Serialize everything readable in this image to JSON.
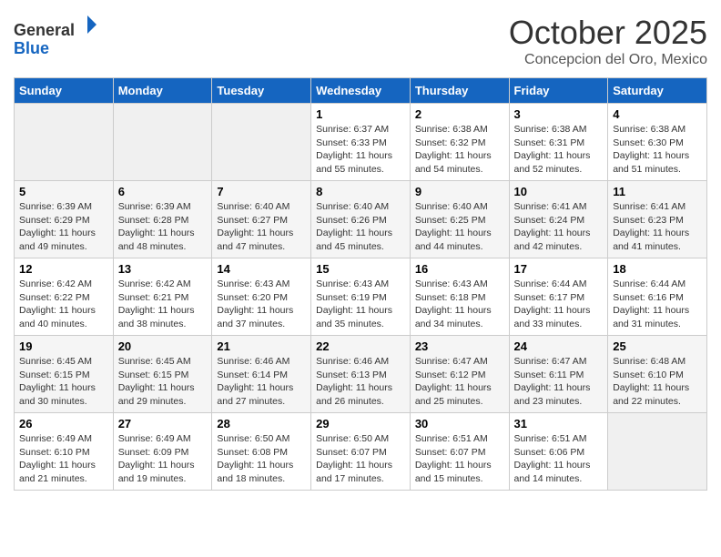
{
  "header": {
    "logo_general": "General",
    "logo_blue": "Blue",
    "month": "October 2025",
    "location": "Concepcion del Oro, Mexico"
  },
  "days_of_week": [
    "Sunday",
    "Monday",
    "Tuesday",
    "Wednesday",
    "Thursday",
    "Friday",
    "Saturday"
  ],
  "weeks": [
    [
      {
        "day": "",
        "empty": true
      },
      {
        "day": "",
        "empty": true
      },
      {
        "day": "",
        "empty": true
      },
      {
        "day": "1",
        "sunrise": "6:37 AM",
        "sunset": "6:33 PM",
        "daylight": "11 hours and 55 minutes."
      },
      {
        "day": "2",
        "sunrise": "6:38 AM",
        "sunset": "6:32 PM",
        "daylight": "11 hours and 54 minutes."
      },
      {
        "day": "3",
        "sunrise": "6:38 AM",
        "sunset": "6:31 PM",
        "daylight": "11 hours and 52 minutes."
      },
      {
        "day": "4",
        "sunrise": "6:38 AM",
        "sunset": "6:30 PM",
        "daylight": "11 hours and 51 minutes."
      }
    ],
    [
      {
        "day": "5",
        "sunrise": "6:39 AM",
        "sunset": "6:29 PM",
        "daylight": "11 hours and 49 minutes."
      },
      {
        "day": "6",
        "sunrise": "6:39 AM",
        "sunset": "6:28 PM",
        "daylight": "11 hours and 48 minutes."
      },
      {
        "day": "7",
        "sunrise": "6:40 AM",
        "sunset": "6:27 PM",
        "daylight": "11 hours and 47 minutes."
      },
      {
        "day": "8",
        "sunrise": "6:40 AM",
        "sunset": "6:26 PM",
        "daylight": "11 hours and 45 minutes."
      },
      {
        "day": "9",
        "sunrise": "6:40 AM",
        "sunset": "6:25 PM",
        "daylight": "11 hours and 44 minutes."
      },
      {
        "day": "10",
        "sunrise": "6:41 AM",
        "sunset": "6:24 PM",
        "daylight": "11 hours and 42 minutes."
      },
      {
        "day": "11",
        "sunrise": "6:41 AM",
        "sunset": "6:23 PM",
        "daylight": "11 hours and 41 minutes."
      }
    ],
    [
      {
        "day": "12",
        "sunrise": "6:42 AM",
        "sunset": "6:22 PM",
        "daylight": "11 hours and 40 minutes."
      },
      {
        "day": "13",
        "sunrise": "6:42 AM",
        "sunset": "6:21 PM",
        "daylight": "11 hours and 38 minutes."
      },
      {
        "day": "14",
        "sunrise": "6:43 AM",
        "sunset": "6:20 PM",
        "daylight": "11 hours and 37 minutes."
      },
      {
        "day": "15",
        "sunrise": "6:43 AM",
        "sunset": "6:19 PM",
        "daylight": "11 hours and 35 minutes."
      },
      {
        "day": "16",
        "sunrise": "6:43 AM",
        "sunset": "6:18 PM",
        "daylight": "11 hours and 34 minutes."
      },
      {
        "day": "17",
        "sunrise": "6:44 AM",
        "sunset": "6:17 PM",
        "daylight": "11 hours and 33 minutes."
      },
      {
        "day": "18",
        "sunrise": "6:44 AM",
        "sunset": "6:16 PM",
        "daylight": "11 hours and 31 minutes."
      }
    ],
    [
      {
        "day": "19",
        "sunrise": "6:45 AM",
        "sunset": "6:15 PM",
        "daylight": "11 hours and 30 minutes."
      },
      {
        "day": "20",
        "sunrise": "6:45 AM",
        "sunset": "6:15 PM",
        "daylight": "11 hours and 29 minutes."
      },
      {
        "day": "21",
        "sunrise": "6:46 AM",
        "sunset": "6:14 PM",
        "daylight": "11 hours and 27 minutes."
      },
      {
        "day": "22",
        "sunrise": "6:46 AM",
        "sunset": "6:13 PM",
        "daylight": "11 hours and 26 minutes."
      },
      {
        "day": "23",
        "sunrise": "6:47 AM",
        "sunset": "6:12 PM",
        "daylight": "11 hours and 25 minutes."
      },
      {
        "day": "24",
        "sunrise": "6:47 AM",
        "sunset": "6:11 PM",
        "daylight": "11 hours and 23 minutes."
      },
      {
        "day": "25",
        "sunrise": "6:48 AM",
        "sunset": "6:10 PM",
        "daylight": "11 hours and 22 minutes."
      }
    ],
    [
      {
        "day": "26",
        "sunrise": "6:49 AM",
        "sunset": "6:10 PM",
        "daylight": "11 hours and 21 minutes."
      },
      {
        "day": "27",
        "sunrise": "6:49 AM",
        "sunset": "6:09 PM",
        "daylight": "11 hours and 19 minutes."
      },
      {
        "day": "28",
        "sunrise": "6:50 AM",
        "sunset": "6:08 PM",
        "daylight": "11 hours and 18 minutes."
      },
      {
        "day": "29",
        "sunrise": "6:50 AM",
        "sunset": "6:07 PM",
        "daylight": "11 hours and 17 minutes."
      },
      {
        "day": "30",
        "sunrise": "6:51 AM",
        "sunset": "6:07 PM",
        "daylight": "11 hours and 15 minutes."
      },
      {
        "day": "31",
        "sunrise": "6:51 AM",
        "sunset": "6:06 PM",
        "daylight": "11 hours and 14 minutes."
      },
      {
        "day": "",
        "empty": true
      }
    ]
  ],
  "labels": {
    "sunrise_label": "Sunrise:",
    "sunset_label": "Sunset:",
    "daylight_label": "Daylight:"
  }
}
